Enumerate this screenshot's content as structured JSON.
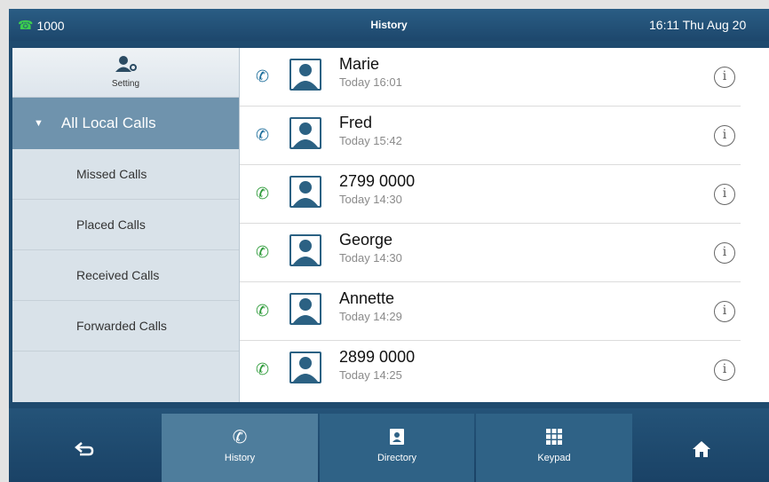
{
  "statusbar": {
    "line_icon": "phone-icon",
    "line_label": "1000",
    "title": "History",
    "datetime": "16:11 Thu Aug 20"
  },
  "sidebar": {
    "setting_label": "Setting",
    "group_label": "All Local Calls",
    "items": [
      {
        "label": "Missed Calls"
      },
      {
        "label": "Placed Calls"
      },
      {
        "label": "Received Calls"
      },
      {
        "label": "Forwarded Calls"
      }
    ]
  },
  "calls": [
    {
      "name": "Marie",
      "time": "Today 16:01",
      "type": "placed",
      "color": "#1f6f9c"
    },
    {
      "name": "Fred",
      "time": "Today 15:42",
      "type": "placed",
      "color": "#1f6f9c"
    },
    {
      "name": "2799 0000",
      "time": "Today 14:30",
      "type": "received",
      "color": "#2e9b3a"
    },
    {
      "name": "George",
      "time": "Today 14:30",
      "type": "received",
      "color": "#2e9b3a"
    },
    {
      "name": "Annette",
      "time": "Today 14:29",
      "type": "received",
      "color": "#2e9b3a"
    },
    {
      "name": "2899 0000",
      "time": "Today 14:25",
      "type": "received",
      "color": "#2e9b3a"
    }
  ],
  "bottombar": {
    "back_icon": "back-arrow-icon",
    "history_label": "History",
    "directory_label": "Directory",
    "keypad_label": "Keypad",
    "home_icon": "home-icon"
  }
}
